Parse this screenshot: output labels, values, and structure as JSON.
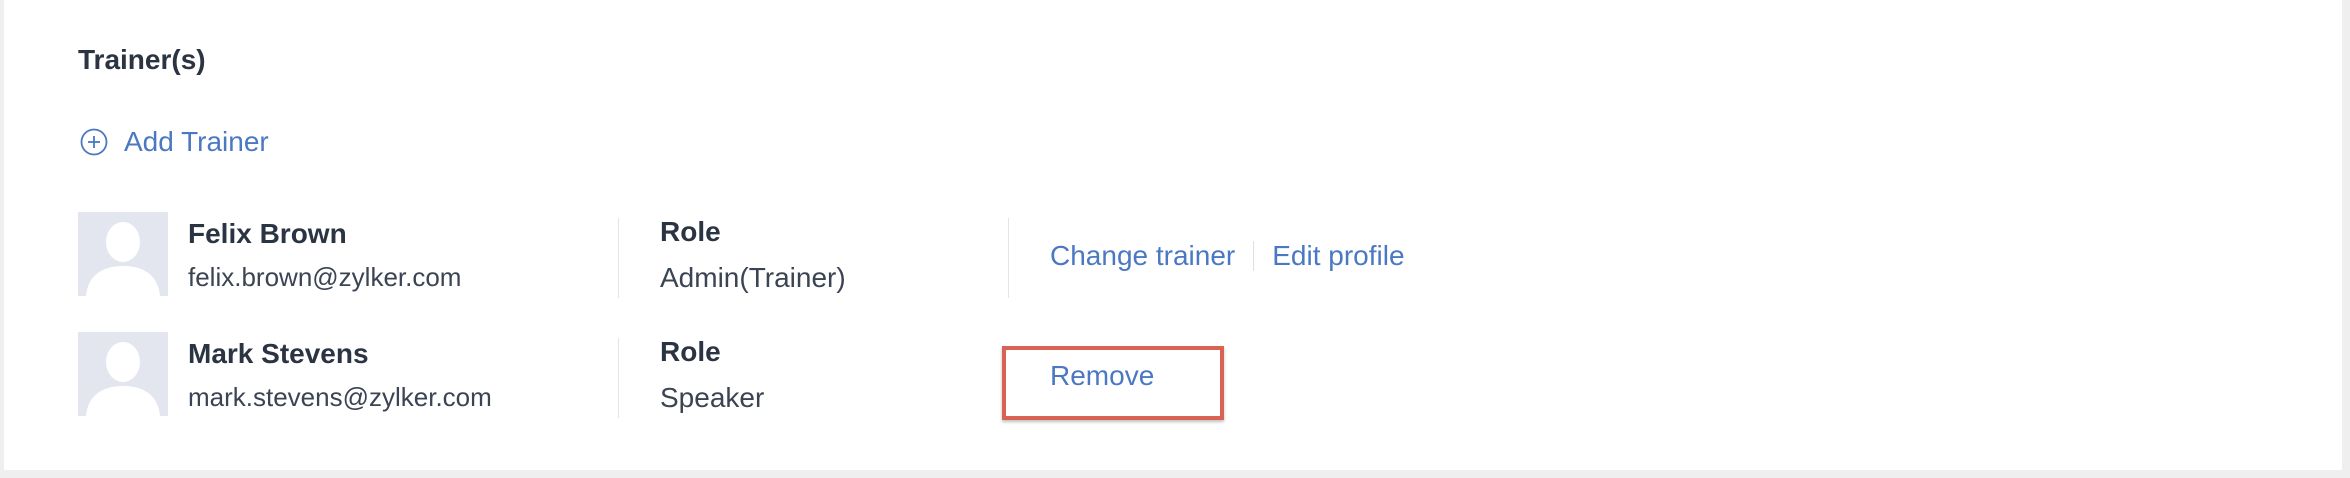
{
  "section": {
    "title": "Trainer(s)",
    "add_label": "Add Trainer"
  },
  "trainers": [
    {
      "name": "Felix Brown",
      "email": "felix.brown@zylker.com",
      "role_label": "Role",
      "role": "Admin(Trainer)",
      "actions": [
        "Change trainer",
        "Edit profile"
      ]
    },
    {
      "name": "Mark Stevens",
      "email": "mark.stevens@zylker.com",
      "role_label": "Role",
      "role": "Speaker",
      "actions": [
        "Remove"
      ]
    }
  ],
  "colors": {
    "link": "#4a78c2",
    "text": "#2b3442",
    "highlight": "#d86355",
    "avatar_bg": "#e3e6ef"
  },
  "icons": {
    "add": "plus-circle-icon",
    "avatar": "user-silhouette-icon"
  }
}
